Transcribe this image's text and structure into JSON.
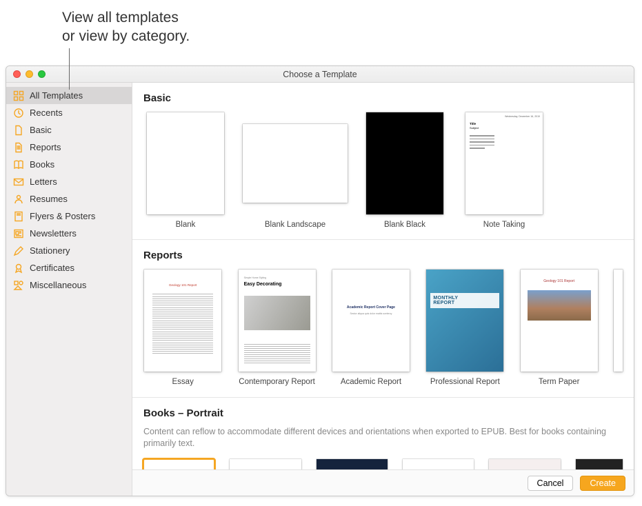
{
  "annotation": "View all templates\nor view by category.",
  "window": {
    "title": "Choose a Template"
  },
  "sidebar": {
    "items": [
      {
        "label": "All Templates",
        "icon": "grid-icon",
        "selected": true
      },
      {
        "label": "Recents",
        "icon": "clock-icon",
        "selected": false
      },
      {
        "label": "Basic",
        "icon": "doc-icon",
        "selected": false
      },
      {
        "label": "Reports",
        "icon": "doc-lines-icon",
        "selected": false
      },
      {
        "label": "Books",
        "icon": "book-icon",
        "selected": false
      },
      {
        "label": "Letters",
        "icon": "envelope-icon",
        "selected": false
      },
      {
        "label": "Resumes",
        "icon": "person-icon",
        "selected": false
      },
      {
        "label": "Flyers & Posters",
        "icon": "poster-icon",
        "selected": false
      },
      {
        "label": "Newsletters",
        "icon": "newspaper-icon",
        "selected": false
      },
      {
        "label": "Stationery",
        "icon": "pencil-icon",
        "selected": false
      },
      {
        "label": "Certificates",
        "icon": "ribbon-icon",
        "selected": false
      },
      {
        "label": "Miscellaneous",
        "icon": "misc-icon",
        "selected": false
      }
    ]
  },
  "sections": {
    "basic": {
      "heading": "Basic",
      "templates": [
        {
          "label": "Blank"
        },
        {
          "label": "Blank Landscape"
        },
        {
          "label": "Blank Black"
        },
        {
          "label": "Note Taking"
        }
      ]
    },
    "reports": {
      "heading": "Reports",
      "templates": [
        {
          "label": "Essay"
        },
        {
          "label": "Contemporary Report"
        },
        {
          "label": "Academic Report"
        },
        {
          "label": "Professional Report"
        },
        {
          "label": "Term Paper"
        }
      ]
    },
    "books": {
      "heading": "Books – Portrait",
      "subtitle": "Content can reflow to accommodate different devices and orientations when exported to EPUB. Best for books containing primarily text."
    }
  },
  "thumb_text": {
    "note_date": "Wednesday, December 16, 2019",
    "note_title": "Title",
    "note_subject": "Subject",
    "essay_title": "Geology 101 Report",
    "contemp_pre": "Simple Home Styling",
    "contemp_title": "Easy Decorating",
    "acad_title": "Academic Report Cover Page",
    "acad_sub": "Sector aliqua quis dolor mattis sceleroy",
    "prof_line": "MONTHLY",
    "prof_line2": "REPORT",
    "term_title": "Geology 101 Report"
  },
  "footer": {
    "cancel": "Cancel",
    "create": "Create"
  }
}
